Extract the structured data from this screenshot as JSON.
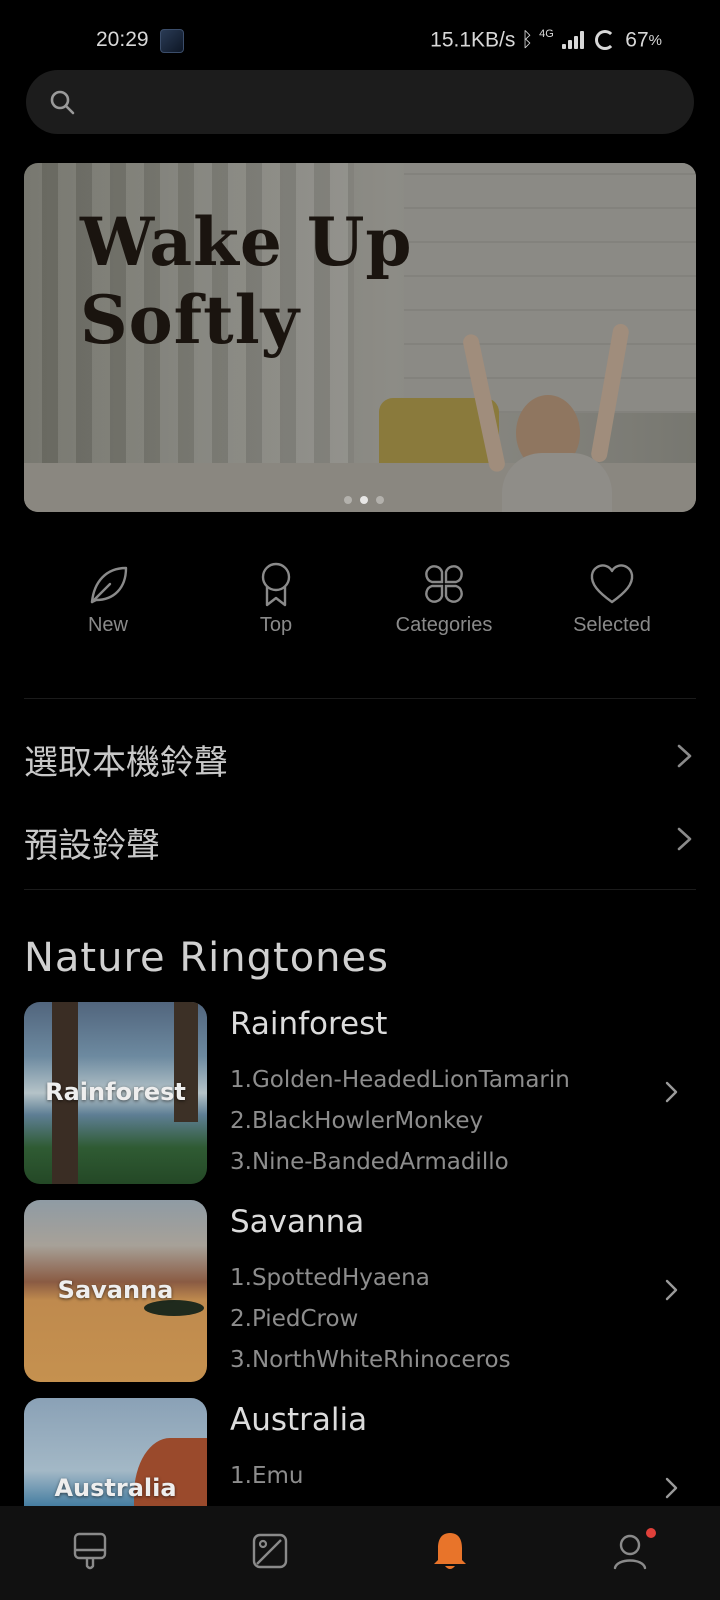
{
  "status_bar": {
    "time": "20:29",
    "network_speed": "15.1KB/s",
    "network_type": "4G",
    "battery": "67",
    "battery_unit": "%"
  },
  "search": {
    "placeholder": ""
  },
  "banner": {
    "title_line1": "Wake Up",
    "title_line2": "Softly",
    "page_count": 3,
    "active_page": 2
  },
  "quick_nav": [
    {
      "label": "New",
      "icon": "leaf-icon"
    },
    {
      "label": "Top",
      "icon": "award-ribbon-icon"
    },
    {
      "label": "Categories",
      "icon": "four-petal-grid-icon"
    },
    {
      "label": "Selected",
      "icon": "heart-icon"
    }
  ],
  "menu_rows": [
    {
      "label": "選取本機鈴聲"
    },
    {
      "label": "預設鈴聲"
    }
  ],
  "section": {
    "title": "Nature Ringtones"
  },
  "collections": [
    {
      "thumb_label": "Rainforest",
      "name": "Rainforest",
      "items": [
        "1.Golden-HeadedLionTamarin",
        "2.BlackHowlerMonkey",
        "3.Nine-BandedArmadillo"
      ]
    },
    {
      "thumb_label": "Savanna",
      "name": "Savanna",
      "items": [
        "1.SpottedHyaena",
        "2.PiedCrow",
        "3.NorthWhiteRhinoceros"
      ]
    },
    {
      "thumb_label": "Australia",
      "name": "Australia",
      "items": [
        "1.Emu"
      ]
    }
  ],
  "bottom_nav": [
    {
      "icon": "theme-icon",
      "active": false
    },
    {
      "icon": "wallpaper-icon",
      "active": false
    },
    {
      "icon": "bell-icon",
      "active": true
    },
    {
      "icon": "profile-icon",
      "active": false,
      "has_badge": true
    }
  ],
  "colors": {
    "background": "#000000",
    "accent": "#e8742a",
    "badge": "#e0403a"
  }
}
